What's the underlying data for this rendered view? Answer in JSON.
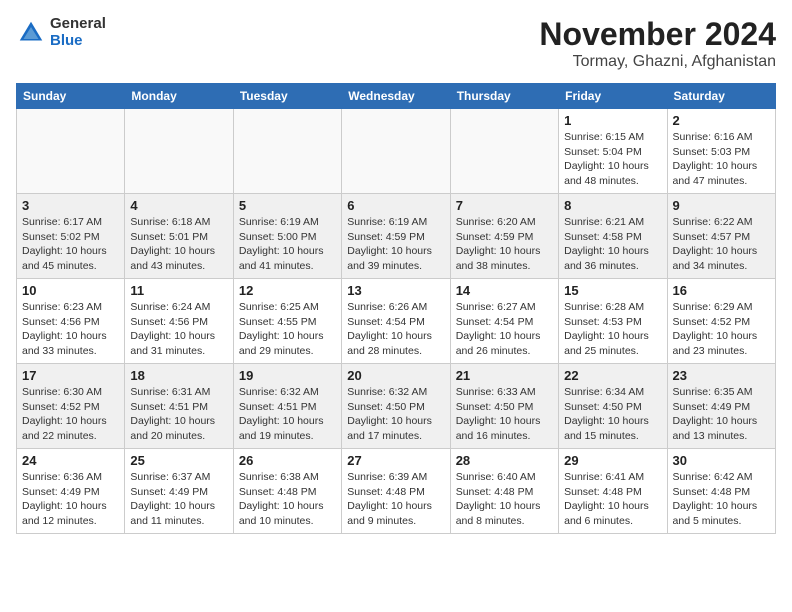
{
  "logo": {
    "general": "General",
    "blue": "Blue"
  },
  "header": {
    "month": "November 2024",
    "location": "Tormay, Ghazni, Afghanistan"
  },
  "weekdays": [
    "Sunday",
    "Monday",
    "Tuesday",
    "Wednesday",
    "Thursday",
    "Friday",
    "Saturday"
  ],
  "weeks": [
    [
      {
        "day": "",
        "info": ""
      },
      {
        "day": "",
        "info": ""
      },
      {
        "day": "",
        "info": ""
      },
      {
        "day": "",
        "info": ""
      },
      {
        "day": "",
        "info": ""
      },
      {
        "day": "1",
        "info": "Sunrise: 6:15 AM\nSunset: 5:04 PM\nDaylight: 10 hours and 48 minutes."
      },
      {
        "day": "2",
        "info": "Sunrise: 6:16 AM\nSunset: 5:03 PM\nDaylight: 10 hours and 47 minutes."
      }
    ],
    [
      {
        "day": "3",
        "info": "Sunrise: 6:17 AM\nSunset: 5:02 PM\nDaylight: 10 hours and 45 minutes."
      },
      {
        "day": "4",
        "info": "Sunrise: 6:18 AM\nSunset: 5:01 PM\nDaylight: 10 hours and 43 minutes."
      },
      {
        "day": "5",
        "info": "Sunrise: 6:19 AM\nSunset: 5:00 PM\nDaylight: 10 hours and 41 minutes."
      },
      {
        "day": "6",
        "info": "Sunrise: 6:19 AM\nSunset: 4:59 PM\nDaylight: 10 hours and 39 minutes."
      },
      {
        "day": "7",
        "info": "Sunrise: 6:20 AM\nSunset: 4:59 PM\nDaylight: 10 hours and 38 minutes."
      },
      {
        "day": "8",
        "info": "Sunrise: 6:21 AM\nSunset: 4:58 PM\nDaylight: 10 hours and 36 minutes."
      },
      {
        "day": "9",
        "info": "Sunrise: 6:22 AM\nSunset: 4:57 PM\nDaylight: 10 hours and 34 minutes."
      }
    ],
    [
      {
        "day": "10",
        "info": "Sunrise: 6:23 AM\nSunset: 4:56 PM\nDaylight: 10 hours and 33 minutes."
      },
      {
        "day": "11",
        "info": "Sunrise: 6:24 AM\nSunset: 4:56 PM\nDaylight: 10 hours and 31 minutes."
      },
      {
        "day": "12",
        "info": "Sunrise: 6:25 AM\nSunset: 4:55 PM\nDaylight: 10 hours and 29 minutes."
      },
      {
        "day": "13",
        "info": "Sunrise: 6:26 AM\nSunset: 4:54 PM\nDaylight: 10 hours and 28 minutes."
      },
      {
        "day": "14",
        "info": "Sunrise: 6:27 AM\nSunset: 4:54 PM\nDaylight: 10 hours and 26 minutes."
      },
      {
        "day": "15",
        "info": "Sunrise: 6:28 AM\nSunset: 4:53 PM\nDaylight: 10 hours and 25 minutes."
      },
      {
        "day": "16",
        "info": "Sunrise: 6:29 AM\nSunset: 4:52 PM\nDaylight: 10 hours and 23 minutes."
      }
    ],
    [
      {
        "day": "17",
        "info": "Sunrise: 6:30 AM\nSunset: 4:52 PM\nDaylight: 10 hours and 22 minutes."
      },
      {
        "day": "18",
        "info": "Sunrise: 6:31 AM\nSunset: 4:51 PM\nDaylight: 10 hours and 20 minutes."
      },
      {
        "day": "19",
        "info": "Sunrise: 6:32 AM\nSunset: 4:51 PM\nDaylight: 10 hours and 19 minutes."
      },
      {
        "day": "20",
        "info": "Sunrise: 6:32 AM\nSunset: 4:50 PM\nDaylight: 10 hours and 17 minutes."
      },
      {
        "day": "21",
        "info": "Sunrise: 6:33 AM\nSunset: 4:50 PM\nDaylight: 10 hours and 16 minutes."
      },
      {
        "day": "22",
        "info": "Sunrise: 6:34 AM\nSunset: 4:50 PM\nDaylight: 10 hours and 15 minutes."
      },
      {
        "day": "23",
        "info": "Sunrise: 6:35 AM\nSunset: 4:49 PM\nDaylight: 10 hours and 13 minutes."
      }
    ],
    [
      {
        "day": "24",
        "info": "Sunrise: 6:36 AM\nSunset: 4:49 PM\nDaylight: 10 hours and 12 minutes."
      },
      {
        "day": "25",
        "info": "Sunrise: 6:37 AM\nSunset: 4:49 PM\nDaylight: 10 hours and 11 minutes."
      },
      {
        "day": "26",
        "info": "Sunrise: 6:38 AM\nSunset: 4:48 PM\nDaylight: 10 hours and 10 minutes."
      },
      {
        "day": "27",
        "info": "Sunrise: 6:39 AM\nSunset: 4:48 PM\nDaylight: 10 hours and 9 minutes."
      },
      {
        "day": "28",
        "info": "Sunrise: 6:40 AM\nSunset: 4:48 PM\nDaylight: 10 hours and 8 minutes."
      },
      {
        "day": "29",
        "info": "Sunrise: 6:41 AM\nSunset: 4:48 PM\nDaylight: 10 hours and 6 minutes."
      },
      {
        "day": "30",
        "info": "Sunrise: 6:42 AM\nSunset: 4:48 PM\nDaylight: 10 hours and 5 minutes."
      }
    ]
  ]
}
